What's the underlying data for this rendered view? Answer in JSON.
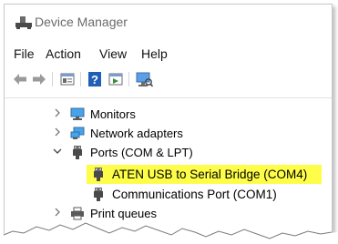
{
  "window": {
    "title": "Device Manager"
  },
  "menu": {
    "items": [
      {
        "label": "File"
      },
      {
        "label": "Action"
      },
      {
        "label": "View"
      },
      {
        "label": "Help"
      }
    ]
  },
  "toolbar": {
    "buttons": [
      {
        "icon": "back-arrow-icon"
      },
      {
        "icon": "forward-arrow-icon"
      },
      {
        "icon": "properties-icon"
      },
      {
        "icon": "help-icon"
      },
      {
        "icon": "show-hidden-icon"
      },
      {
        "icon": "scan-hardware-icon"
      }
    ]
  },
  "tree": {
    "monitors": {
      "label": "Monitors",
      "expanded": false
    },
    "network_adapters": {
      "label": "Network adapters",
      "expanded": false
    },
    "ports": {
      "label": "Ports (COM & LPT)",
      "expanded": true,
      "children": [
        {
          "label": "ATEN USB to Serial Bridge (COM4)",
          "highlighted": true
        },
        {
          "label": "Communications Port (COM1)",
          "highlighted": false
        }
      ]
    },
    "print_queues": {
      "label": "Print queues",
      "expanded": false
    }
  },
  "colors": {
    "highlight": "#fdfd4a",
    "title_text": "#6b6b6b",
    "help_blue": "#1f5fb8"
  }
}
